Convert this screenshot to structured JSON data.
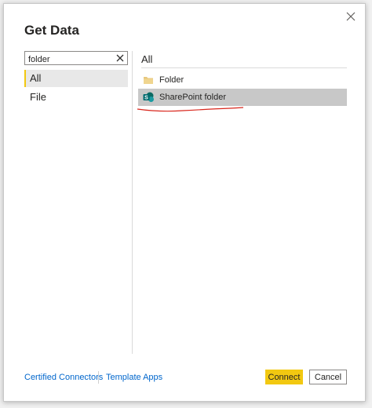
{
  "dialog": {
    "title": "Get Data",
    "close_icon": "close-icon"
  },
  "search": {
    "value": "folder",
    "placeholder": "",
    "clear_icon": "clear-icon"
  },
  "categories": [
    {
      "label": "All",
      "selected": true
    },
    {
      "label": "File",
      "selected": false
    }
  ],
  "results": {
    "header": "All",
    "items": [
      {
        "label": "Folder",
        "icon": "folder-icon",
        "selected": false
      },
      {
        "label": "SharePoint folder",
        "icon": "sharepoint-icon",
        "selected": true
      }
    ]
  },
  "footer": {
    "certified_connectors": "Certified Connectors",
    "template_apps": "Template Apps",
    "connect_label": "Connect",
    "cancel_label": "Cancel"
  },
  "colors": {
    "accent": "#f2c811",
    "link": "#0066cc",
    "selection": "#c8c8c8",
    "annotation": "#d9261c"
  }
}
